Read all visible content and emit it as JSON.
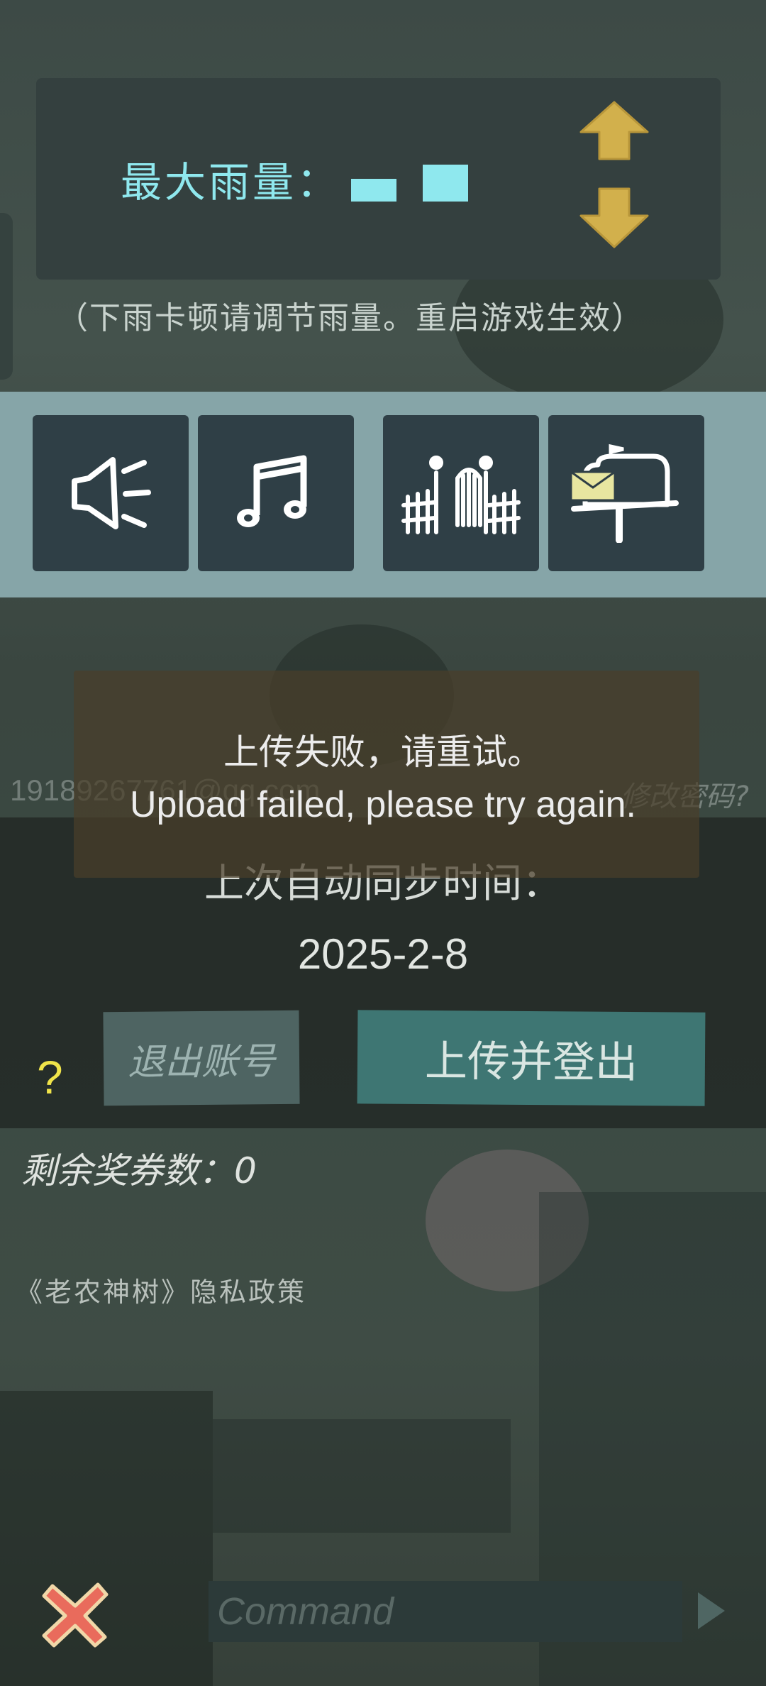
{
  "rain_settings": {
    "label": "最大雨量：",
    "note": "（下雨卡顿请调节雨量。重启游戏生效）",
    "up_icon": "arrow-up-icon",
    "down_icon": "arrow-down-icon"
  },
  "toolbar": {
    "items": [
      {
        "name": "sound",
        "icon": "speaker-icon"
      },
      {
        "name": "music",
        "icon": "music-note-icon"
      },
      {
        "name": "fence",
        "icon": "fence-icon"
      },
      {
        "name": "mailbox",
        "icon": "mailbox-icon"
      }
    ]
  },
  "toast": {
    "message_cn": "上传失败，请重试。",
    "message_en": "Upload failed, please try again."
  },
  "account": {
    "email": "19189267761@qq.com",
    "change_password": "修改密码?",
    "last_sync_label": "上次自动同步时间：",
    "last_sync_date": "2025-2-8",
    "logout_label": "退出账号",
    "upload_logout_label": "上传并登出",
    "help": "?"
  },
  "tickets": "剩余奖券数：0",
  "privacy_link": "《老农神树》隐私政策",
  "command": {
    "placeholder": "Command",
    "close_icon": "close-x-icon",
    "send_icon": "play-send-icon"
  },
  "colors": {
    "accent_cyan": "#8fe8ee",
    "arrow_gold": "#d2b04c",
    "upload_button": "#3e7673",
    "help_yellow": "#f0e44a",
    "close_red": "#e96b5c"
  }
}
